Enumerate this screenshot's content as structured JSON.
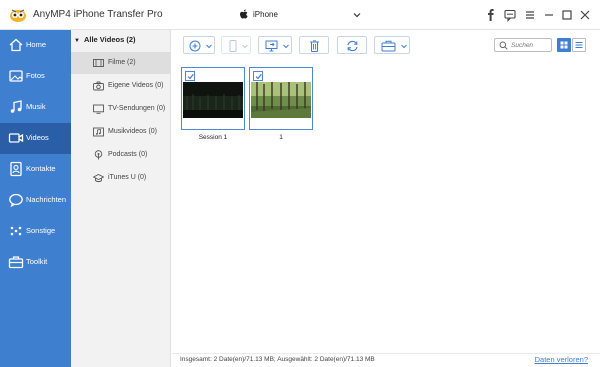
{
  "window": {
    "title": "AnyMP4 iPhone Transfer Pro",
    "device": "iPhone"
  },
  "sidebar": {
    "items": [
      {
        "label": "Home",
        "icon": "home-icon",
        "active": false
      },
      {
        "label": "Fotos",
        "icon": "photo-icon",
        "active": false
      },
      {
        "label": "Musik",
        "icon": "music-icon",
        "active": false
      },
      {
        "label": "Videos",
        "icon": "video-icon",
        "active": true
      },
      {
        "label": "Kontakte",
        "icon": "contacts-icon",
        "active": false
      },
      {
        "label": "Nachrichten",
        "icon": "message-icon",
        "active": false
      },
      {
        "label": "Sonstige",
        "icon": "more-icon",
        "active": false
      },
      {
        "label": "Toolkit",
        "icon": "toolkit-icon",
        "active": false
      }
    ]
  },
  "categories": {
    "header": "Alle Videos (2)",
    "items": [
      {
        "label": "Filme (2)",
        "icon": "film-icon",
        "active": true
      },
      {
        "label": "Eigene Videos (0)",
        "icon": "camera-icon",
        "active": false
      },
      {
        "label": "TV-Sendungen (0)",
        "icon": "tv-icon",
        "active": false
      },
      {
        "label": "Musikvideos (0)",
        "icon": "music-video-icon",
        "active": false
      },
      {
        "label": "Podcasts (0)",
        "icon": "podcast-icon",
        "active": false
      },
      {
        "label": "iTunes U (0)",
        "icon": "itunes-u-icon",
        "active": false
      }
    ]
  },
  "toolbar": {
    "search_placeholder": "Suchen"
  },
  "videos": [
    {
      "label": "Session 1",
      "checked": true
    },
    {
      "label": "1",
      "checked": true
    }
  ],
  "status": {
    "summary": "Insgesamt: 2 Date(en)/71.13 MB; Ausgewählt: 2 Date(en)/71.13 MB",
    "link": "Daten verloren?"
  },
  "colors": {
    "accent": "#3f7fd0",
    "sidebar_active": "#2a5fa8"
  }
}
